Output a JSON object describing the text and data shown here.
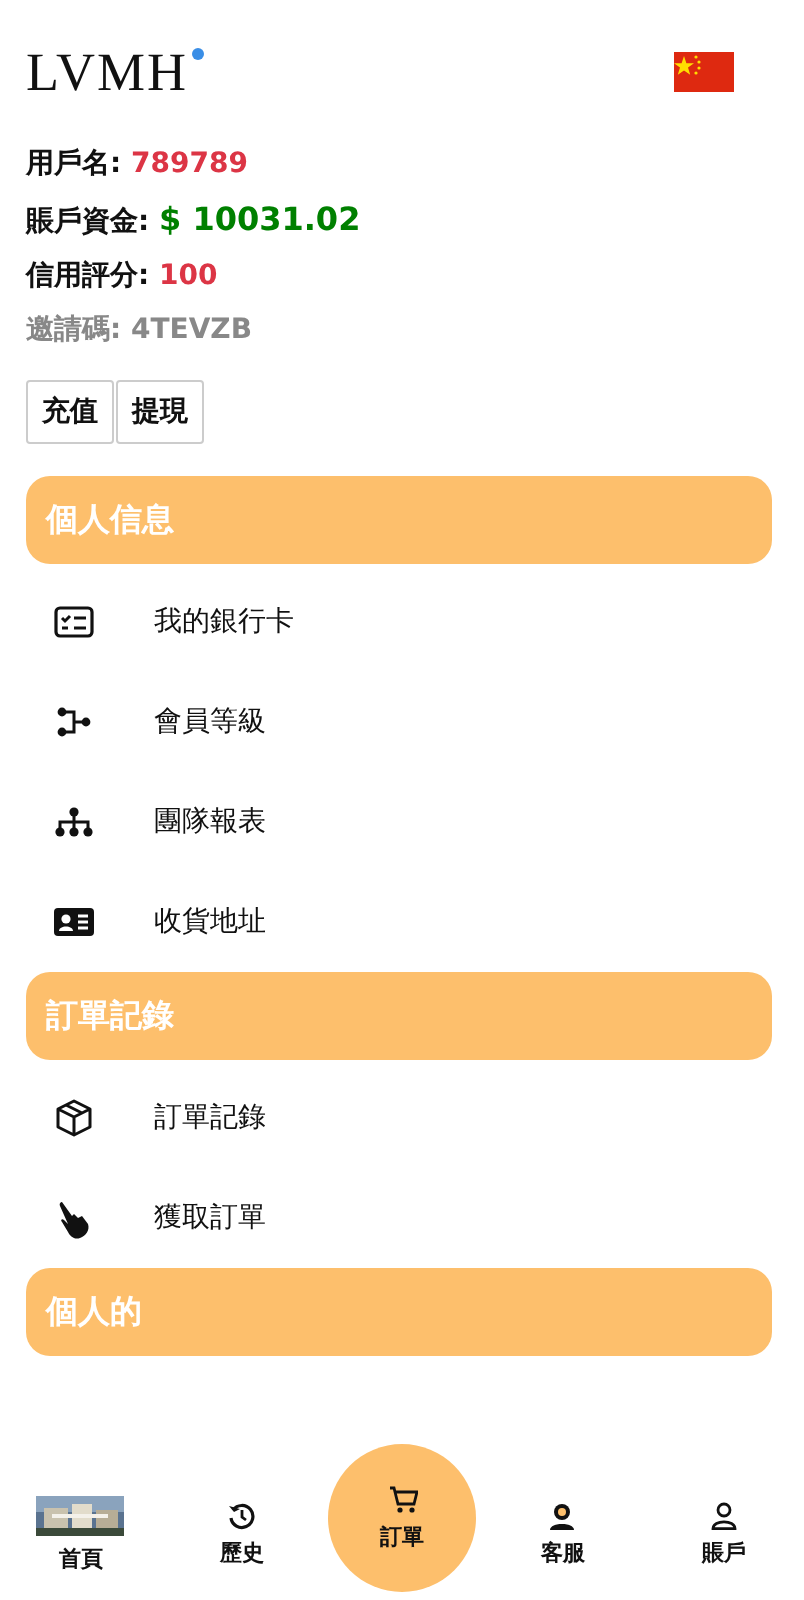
{
  "header": {
    "logo": "LVMH"
  },
  "account": [
    {
      "label": "用戶名:",
      "value": "789789",
      "kind": "red"
    },
    {
      "label": "賬戶資金:",
      "value": "$ 10031.02",
      "kind": "green"
    },
    {
      "label": "信用評分:",
      "value": "100",
      "kind": "red"
    },
    {
      "label": "邀請碼:",
      "value": "4TEVZB",
      "kind": "muted"
    }
  ],
  "buttons": [
    "充值",
    "提現"
  ],
  "sections": [
    {
      "title": "個人信息",
      "items": [
        {
          "label": "我的銀行卡",
          "kind": "card"
        },
        {
          "label": "會員等級",
          "kind": "levels"
        },
        {
          "label": "團隊報表",
          "kind": "team"
        },
        {
          "label": "收貨地址",
          "kind": "idcard"
        }
      ]
    },
    {
      "title": "訂單記錄",
      "items": [
        {
          "label": "訂單記錄",
          "kind": "box"
        },
        {
          "label": "獲取訂單",
          "kind": "hand"
        }
      ]
    },
    {
      "title": "個人的"
    }
  ],
  "nav": [
    {
      "label": "首頁",
      "kind": "picture",
      "selected": false
    },
    {
      "label": "歷史",
      "kind": "history",
      "selected": false
    },
    {
      "label": "訂單",
      "kind": "cart",
      "selected": true
    },
    {
      "label": "客服",
      "kind": "support",
      "selected": false
    },
    {
      "label": "賬戶",
      "kind": "user",
      "selected": false
    }
  ]
}
